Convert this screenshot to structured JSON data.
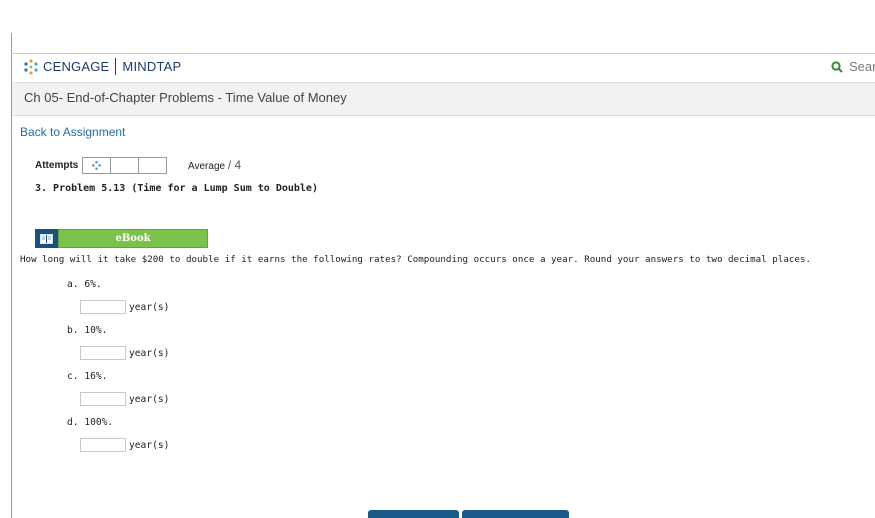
{
  "header": {
    "brand": "CENGAGE",
    "product": "MINDTAP",
    "search_label": "Search",
    "brand_color": "#1e3a6e"
  },
  "assignment": {
    "title": "Ch 05- End-of-Chapter Problems - Time Value of Money",
    "back_link": "Back to Assignment"
  },
  "attempts": {
    "label": "Attempts",
    "average_label": "Average",
    "average_value": "/ 4"
  },
  "problem": {
    "title": "3.  Problem 5.13 (Time for a Lump Sum to Double)",
    "ebook_label": "eBook",
    "question": "How long will it take $200 to double if it earns the following rates? Compounding occurs once a year. Round your answers to two decimal places.",
    "parts": [
      {
        "label": "a. 6%.",
        "value": "",
        "unit": "year(s)"
      },
      {
        "label": "b. 10%.",
        "value": "",
        "unit": "year(s)"
      },
      {
        "label": "c. 16%.",
        "value": "",
        "unit": "year(s)"
      },
      {
        "label": "d. 100%.",
        "value": "",
        "unit": "year(s)"
      }
    ]
  },
  "colors": {
    "link": "#1d6fa8",
    "ebook_green": "#7bc24a",
    "ebook_book_bg": "#1b4f7c",
    "footer_button": "#1a5a8a"
  }
}
